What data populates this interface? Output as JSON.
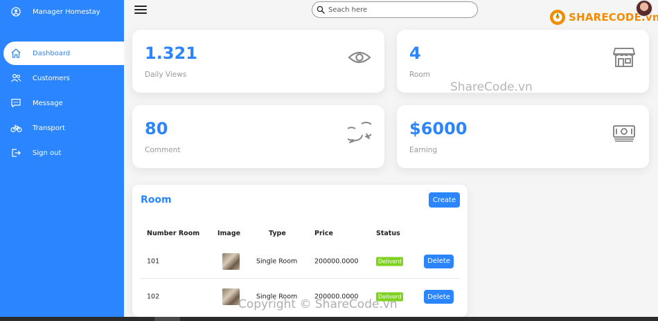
{
  "sidebar": {
    "brand": {
      "label": "Manager Homestay",
      "icon": "user-circle-icon"
    },
    "items": [
      {
        "label": "Dashboard",
        "icon": "home-icon",
        "active": true
      },
      {
        "label": "Customers",
        "icon": "people-icon",
        "active": false
      },
      {
        "label": "Message",
        "icon": "chat-icon",
        "active": false
      },
      {
        "label": "Transport",
        "icon": "bicycle-icon",
        "active": false
      },
      {
        "label": "Sign out",
        "icon": "sign-out-icon",
        "active": false
      }
    ]
  },
  "topbar": {
    "search_placeholder": "Seach here",
    "logo_text": "SHARECODE.vn"
  },
  "cards": [
    {
      "value": "1.321",
      "caption": "Daily Views",
      "icon": "eye-icon"
    },
    {
      "value": "4",
      "caption": "Room",
      "icon": "store-icon"
    },
    {
      "value": "80",
      "caption": "Comment",
      "icon": "comment-icon"
    },
    {
      "value": "$6000",
      "caption": "Earning",
      "icon": "money-icon"
    }
  ],
  "room_panel": {
    "title": "Room",
    "create_label": "Create",
    "columns": [
      "Number Room",
      "Image",
      "Type",
      "Price",
      "Status"
    ],
    "rows": [
      {
        "number": "101",
        "type": "Single Room",
        "price": "200000.0000",
        "status": "Deliverd",
        "action": "Delete"
      },
      {
        "number": "102",
        "type": "Single Room",
        "price": "200000.0000",
        "status": "Deliverd",
        "action": "Delete"
      }
    ]
  },
  "watermarks": {
    "top": "ShareCode.vn",
    "bottom": "Copyright © ShareCode.vn"
  },
  "colors": {
    "accent": "#2a85ff",
    "status_green": "#7ed321",
    "logo_orange": "#f28c00"
  }
}
